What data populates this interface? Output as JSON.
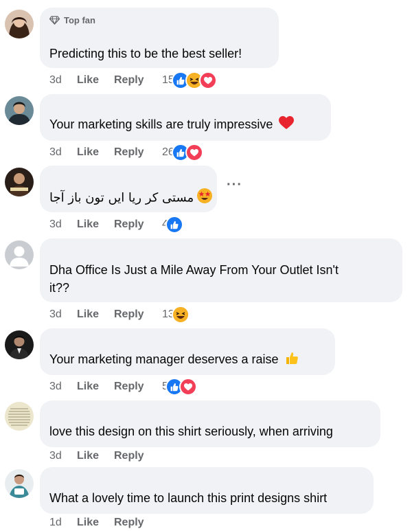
{
  "comments": [
    {
      "badge": "Top fan",
      "text": "Predicting this to be the best seller!",
      "time": "3d",
      "like": "Like",
      "reply": "Reply",
      "reactions_count": "15",
      "reactions": [
        "like-icon",
        "haha-icon",
        "love-icon"
      ],
      "avatar_color": "#8a5a4a"
    },
    {
      "badge": "",
      "text": "Your marketing skills are truly impressive",
      "trailing_emoji": "red-heart-icon",
      "time": "3d",
      "like": "Like",
      "reply": "Reply",
      "reactions_count": "26",
      "reactions": [
        "like-icon",
        "love-icon"
      ],
      "avatar_color": "#3a5a6a"
    },
    {
      "badge": "",
      "text": "مستی کر ریا ایں تون باز آجا",
      "leading_emoji": "star-struck-icon",
      "time": "3d",
      "like": "Like",
      "reply": "Reply",
      "reactions_count": "4",
      "reactions": [
        "like-icon"
      ],
      "avatar_color": "#5a4030"
    },
    {
      "badge": "",
      "text_line1": "Dha Office Is Just a Mile Away From Your Outlet Isn't",
      "text_line2": "it??",
      "time": "3d",
      "like": "Like",
      "reply": "Reply",
      "reactions_count": "13",
      "reactions": [
        "haha-icon"
      ],
      "avatar_color": "#c9ccd1"
    },
    {
      "badge": "",
      "text": "Your marketing manager deserves a raise",
      "trailing_emoji": "thumbs-up-emoji-icon",
      "time": "3d",
      "like": "Like",
      "reply": "Reply",
      "reactions_count": "5",
      "reactions": [
        "like-icon",
        "love-icon"
      ],
      "avatar_color": "#2a2a2a"
    },
    {
      "badge": "",
      "text": "love this design on this shirt seriously, when arriving",
      "time": "3d",
      "like": "Like",
      "reply": "Reply",
      "reactions_count": "",
      "reactions": [],
      "avatar_color": "#d8d2b8"
    },
    {
      "badge": "",
      "text": "What a lovely time to launch this print designs shirt",
      "time": "1d",
      "like": "Like",
      "reply": "Reply",
      "reactions_count": "",
      "reactions": [],
      "avatar_color": "#6a9aa0"
    }
  ],
  "colors": {
    "bubble": "#f0f2f5",
    "like_blue": "#1877f2",
    "love_red": "#f33e58",
    "haha_yellow": "#f7b125",
    "meta_gray": "#65676b"
  }
}
